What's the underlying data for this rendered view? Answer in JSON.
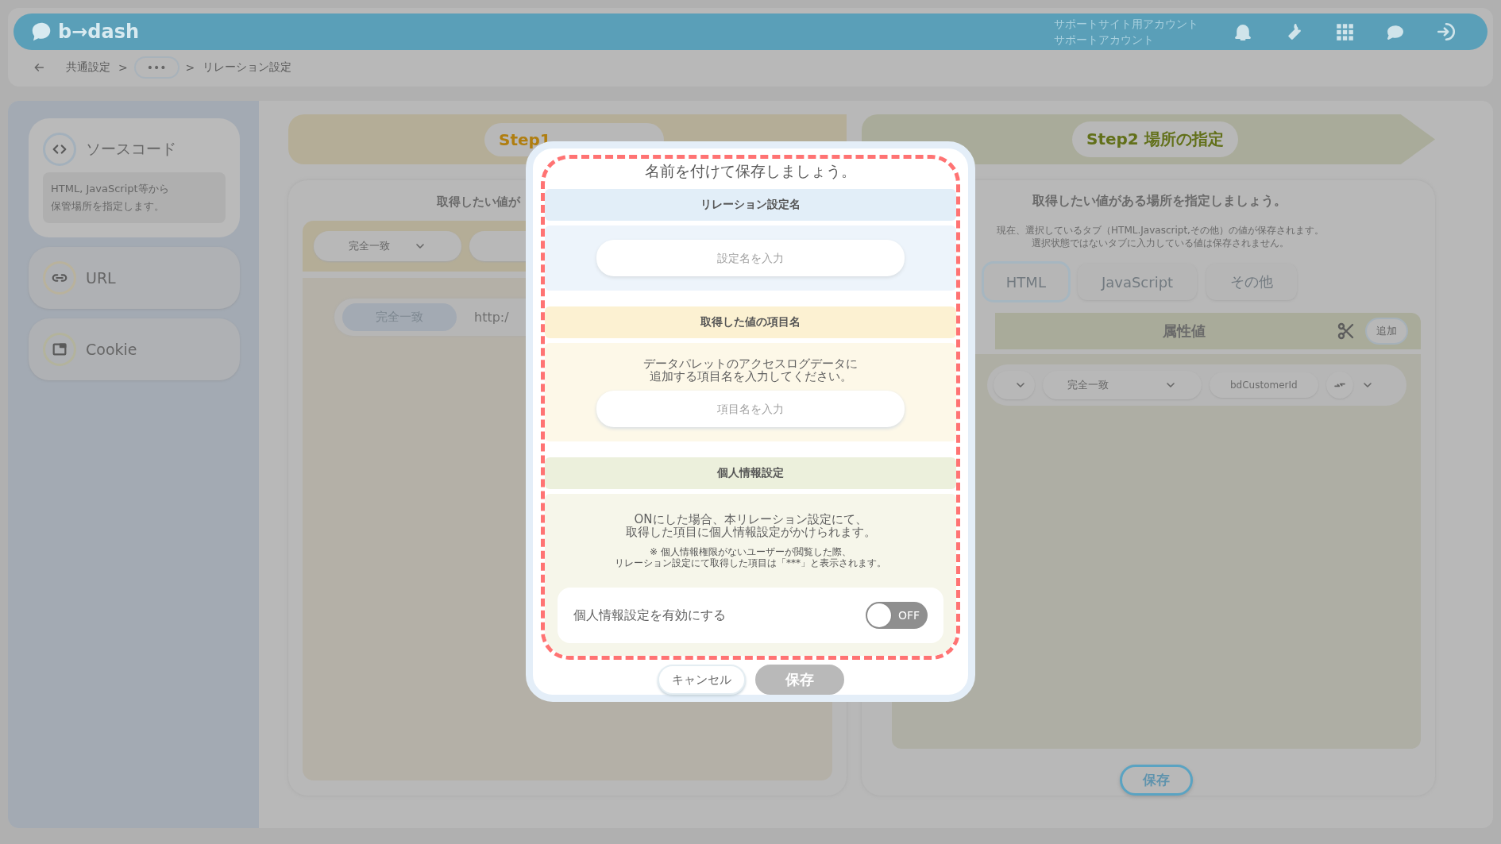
{
  "header": {
    "logo": "b→dash",
    "account_lines": [
      "サポートサイト用アカウント",
      "サポートアカウント"
    ]
  },
  "breadcrumb": [
    {
      "kind": "link",
      "label": "共通設定"
    },
    {
      "kind": "separator",
      "label": ">"
    },
    {
      "kind": "more",
      "label": "•••"
    },
    {
      "kind": "separator",
      "label": ">"
    },
    {
      "kind": "current",
      "label": "リレーション設定"
    }
  ],
  "sidebar": {
    "items": [
      {
        "kind": "code",
        "label": "ソースコード",
        "description": [
          "HTML, JavaScript等から",
          "保管場所を指定します。"
        ],
        "selected": true
      },
      {
        "kind": "link",
        "label": "URL",
        "selected": false
      },
      {
        "kind": "window",
        "label": "Cookie",
        "selected": false
      }
    ]
  },
  "step1": {
    "title": "Step1",
    "prompt": "取得したい値が",
    "match_select": "完全一致",
    "rule": {
      "match": "完全一致",
      "url": "http:/"
    }
  },
  "step2": {
    "title": "Step2 場所の指定",
    "prompt": "取得したい値がある場所を指定しましょう。",
    "notes": [
      "現在、選択しているタブ（HTML.Javascript,その他）の値が保存されます。",
      "選択状態ではないタブに入力している値は保存されません。"
    ],
    "tabs": [
      {
        "label": "HTML",
        "selected": true
      },
      {
        "label": "JavaScript",
        "selected": false
      },
      {
        "label": "その他",
        "selected": false
      }
    ],
    "attribute_header": "属性値",
    "add_button": "追加",
    "row": {
      "match_select": "完全一致",
      "value": "bdCustomerId"
    },
    "save_button": "保存"
  },
  "dialog": {
    "title": "名前を付けて保存しましょう。",
    "sections": [
      {
        "kind": "name",
        "heading": "リレーション設定名",
        "placeholder": "設定名を入力"
      },
      {
        "kind": "item",
        "heading": "取得した値の項目名",
        "description": [
          "データパレットのアクセスログデータに",
          "追加する項目名を入力してください。"
        ],
        "placeholder": "項目名を入力"
      },
      {
        "kind": "privacy",
        "heading": "個人情報設定",
        "description": [
          "ONにした場合、本リレーション設定にて、",
          "取得した項目に個人情報設定がかけられます。"
        ],
        "note": [
          "※ 個人情報権限がないユーザーが閲覧した際、",
          "リレーション設定にて取得した項目は「***」と表示されます。"
        ],
        "toggle": {
          "label": "個人情報設定を有効にする",
          "on": false,
          "state_text": "OFF"
        }
      }
    ],
    "buttons": [
      {
        "label": "キャンセル",
        "disabled": false
      },
      {
        "label": "保存",
        "disabled": true
      }
    ]
  }
}
